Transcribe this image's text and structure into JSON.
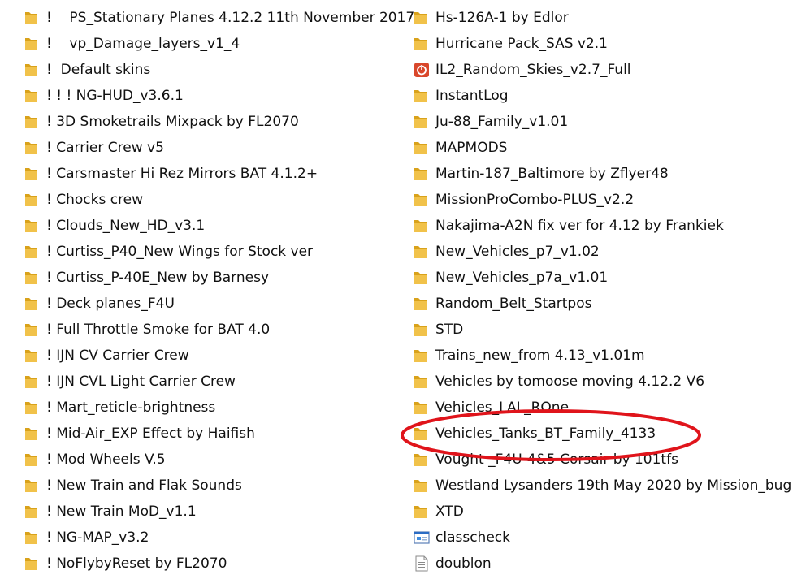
{
  "colors": {
    "folder": "#f1c24a",
    "folder_dark": "#d9a21b",
    "annotation": "#e0141b",
    "text": "#111111"
  },
  "left_items": [
    {
      "label": "!    PS_Stationary Planes 4.12.2 11th November 2017",
      "icon": "folder-icon"
    },
    {
      "label": "!    vp_Damage_layers_v1_4",
      "icon": "folder-icon"
    },
    {
      "label": "!  Default skins",
      "icon": "folder-icon"
    },
    {
      "label": "! ! ! NG-HUD_v3.6.1",
      "icon": "folder-icon"
    },
    {
      "label": "! 3D Smoketrails Mixpack by FL2070",
      "icon": "folder-icon"
    },
    {
      "label": "! Carrier Crew v5",
      "icon": "folder-icon"
    },
    {
      "label": "! Carsmaster Hi Rez Mirrors BAT 4.1.2+",
      "icon": "folder-icon"
    },
    {
      "label": "! Chocks crew",
      "icon": "folder-icon"
    },
    {
      "label": "! Clouds_New_HD_v3.1",
      "icon": "folder-icon"
    },
    {
      "label": "! Curtiss_P40_New Wings for Stock ver",
      "icon": "folder-icon"
    },
    {
      "label": "! Curtiss_P-40E_New by Barnesy",
      "icon": "folder-icon"
    },
    {
      "label": "! Deck planes_F4U",
      "icon": "folder-icon"
    },
    {
      "label": "! Full Throttle Smoke for BAT 4.0",
      "icon": "folder-icon"
    },
    {
      "label": "! IJN CV Carrier Crew",
      "icon": "folder-icon"
    },
    {
      "label": "! IJN CVL Light Carrier Crew",
      "icon": "folder-icon"
    },
    {
      "label": "! Mart_reticle-brightness",
      "icon": "folder-icon"
    },
    {
      "label": "! Mid-Air_EXP Effect by Haifish",
      "icon": "folder-icon"
    },
    {
      "label": "! Mod Wheels V.5",
      "icon": "folder-icon"
    },
    {
      "label": "! New Train and Flak Sounds",
      "icon": "folder-icon"
    },
    {
      "label": "! New Train MoD_v1.1",
      "icon": "folder-icon"
    },
    {
      "label": "! NG-MAP_v3.2",
      "icon": "folder-icon"
    },
    {
      "label": "! NoFlybyReset by FL2070",
      "icon": "folder-icon"
    }
  ],
  "right_items": [
    {
      "label": "Hs-126A-1 by Edlor",
      "icon": "folder-icon"
    },
    {
      "label": "Hurricane Pack_SAS v2.1",
      "icon": "folder-icon"
    },
    {
      "label": "IL2_Random_Skies_v2.7_Full",
      "icon": "power-app-icon"
    },
    {
      "label": "InstantLog",
      "icon": "folder-icon"
    },
    {
      "label": "Ju-88_Family_v1.01",
      "icon": "folder-icon"
    },
    {
      "label": "MAPMODS",
      "icon": "folder-icon"
    },
    {
      "label": "Martin-187_Baltimore by Zflyer48",
      "icon": "folder-icon"
    },
    {
      "label": "MissionProCombo-PLUS_v2.2",
      "icon": "folder-icon"
    },
    {
      "label": "Nakajima-A2N fix ver for 4.12 by Frankiek",
      "icon": "folder-icon"
    },
    {
      "label": "New_Vehicles_p7_v1.02",
      "icon": "folder-icon"
    },
    {
      "label": "New_Vehicles_p7a_v1.01",
      "icon": "folder-icon"
    },
    {
      "label": "Random_Belt_Startpos",
      "icon": "folder-icon"
    },
    {
      "label": "STD",
      "icon": "folder-icon"
    },
    {
      "label": "Trains_new_from 4.13_v1.01m",
      "icon": "folder-icon"
    },
    {
      "label": "Vehicles by tomoose moving 4.12.2 V6",
      "icon": "folder-icon"
    },
    {
      "label": "Vehicles_LAL_ROne",
      "icon": "folder-icon"
    },
    {
      "label": "Vehicles_Tanks_BT_Family_4133",
      "icon": "folder-icon",
      "highlighted": true
    },
    {
      "label": "Vought _F4U-4&5 Corsair by 101tfs",
      "icon": "folder-icon"
    },
    {
      "label": "Westland Lysanders 19th May 2020 by Mission_bug",
      "icon": "folder-icon"
    },
    {
      "label": "XTD",
      "icon": "folder-icon"
    },
    {
      "label": "classcheck",
      "icon": "window-app-icon"
    },
    {
      "label": "doublon",
      "icon": "text-file-icon"
    }
  ]
}
